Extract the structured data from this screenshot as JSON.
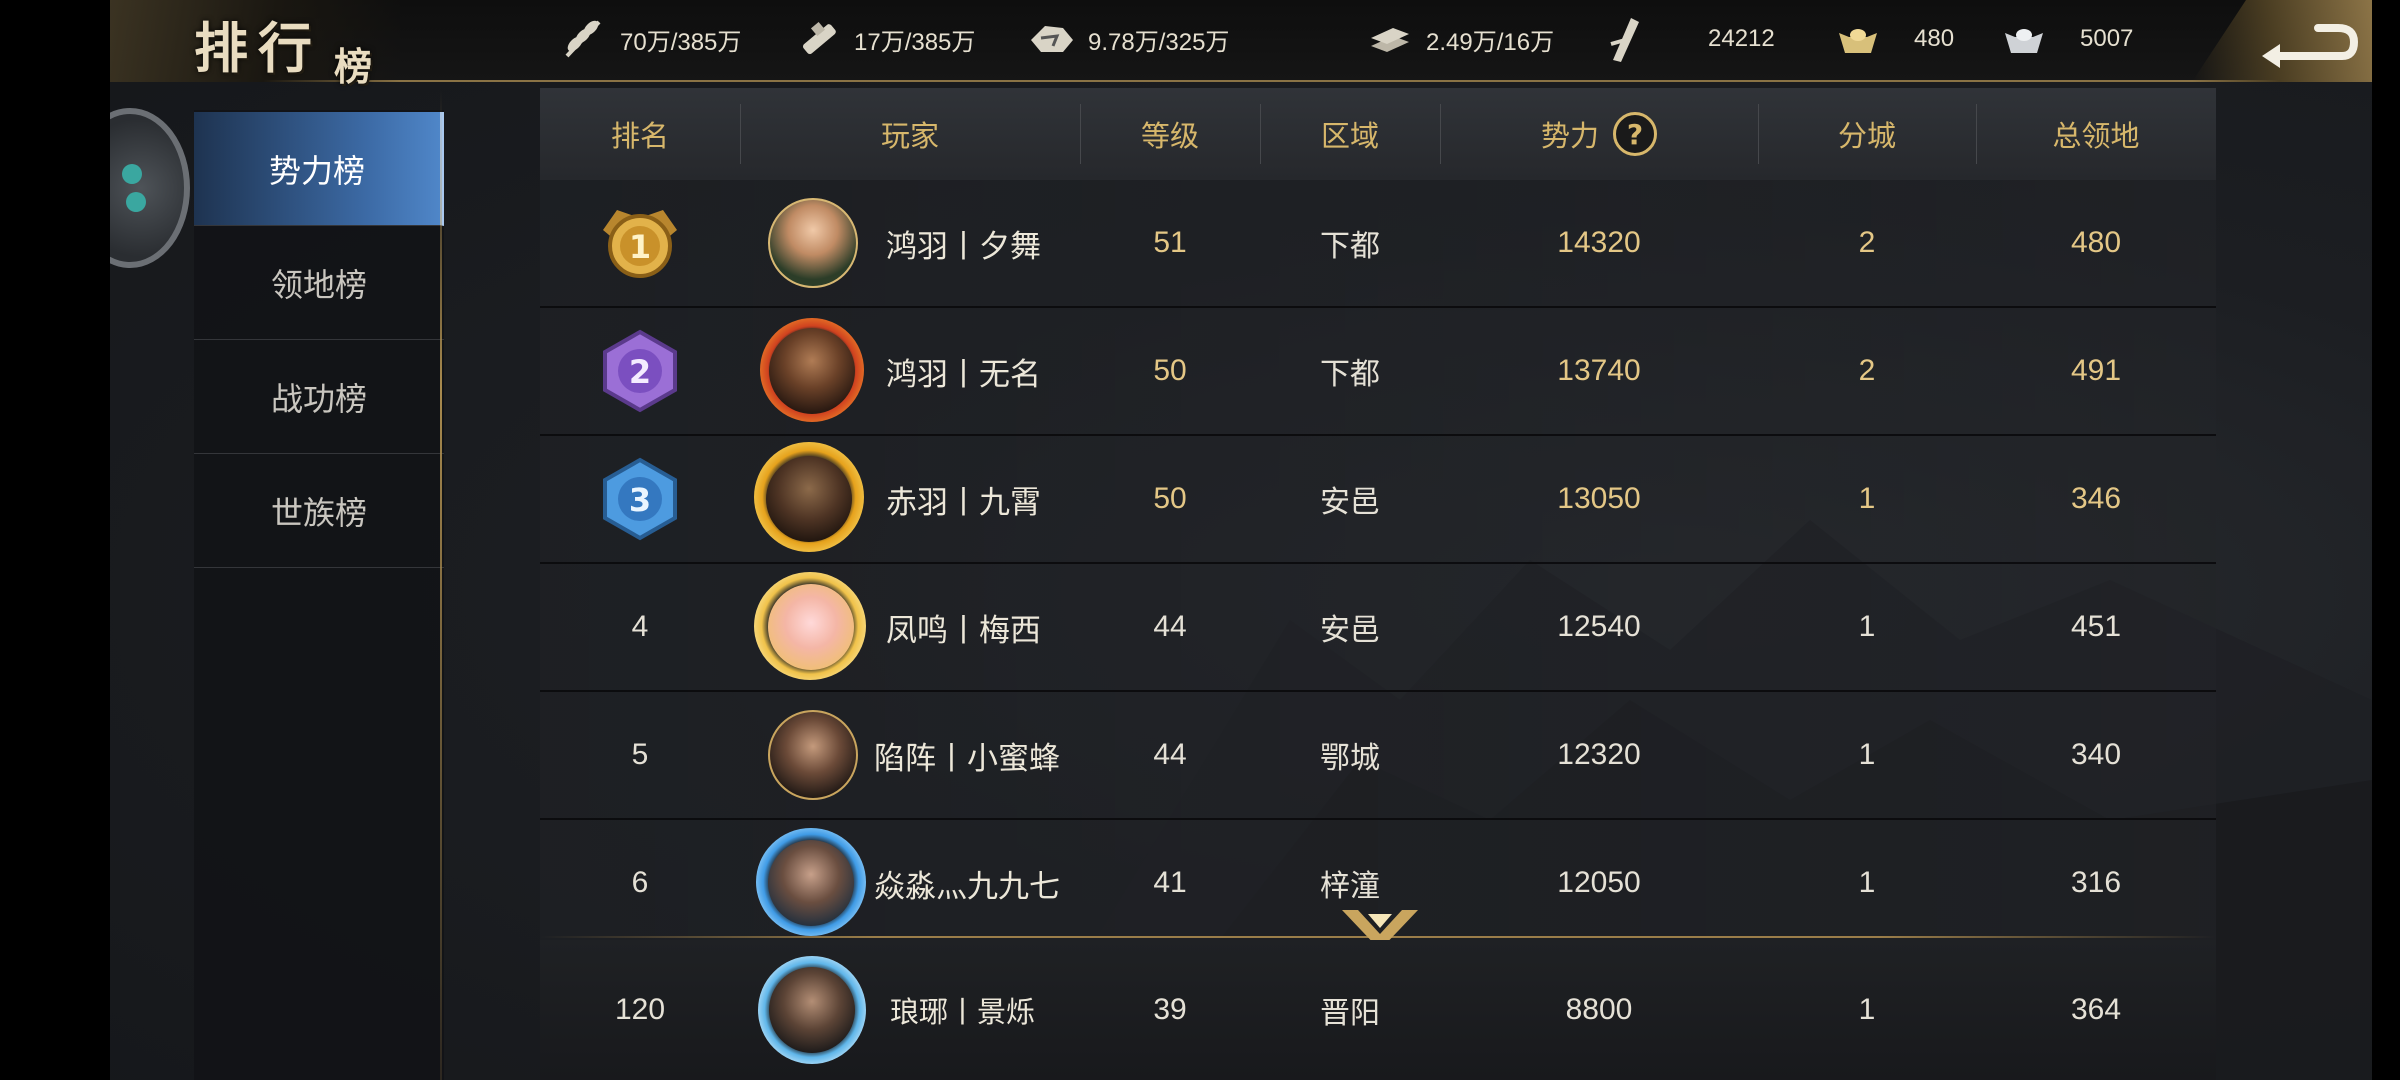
{
  "header": {
    "title_main": "排行",
    "title_sub": "榜",
    "resources": [
      {
        "icon": "wheat-icon",
        "value": "70万/385万"
      },
      {
        "icon": "wood-icon",
        "value": "17万/385万"
      },
      {
        "icon": "stone-icon",
        "value": "9.78万/325万"
      },
      {
        "icon": "iron-icon",
        "value": "2.49万/16万"
      },
      {
        "icon": "decree-icon",
        "value": "24212"
      },
      {
        "icon": "gold-ingot-icon",
        "value": "480"
      },
      {
        "icon": "silver-ingot-icon",
        "value": "5007"
      }
    ]
  },
  "nav": {
    "items": [
      {
        "label": "势力榜",
        "active": true
      },
      {
        "label": "领地榜",
        "active": false
      },
      {
        "label": "战功榜",
        "active": false
      },
      {
        "label": "世族榜",
        "active": false
      }
    ]
  },
  "table": {
    "columns": {
      "rank": "排名",
      "player": "玩家",
      "level": "等级",
      "region": "区域",
      "power": "势力",
      "branch": "分城",
      "territory": "总领地"
    },
    "rows": [
      {
        "rank": "1",
        "name": "鸿羽丨夕舞",
        "level": "51",
        "region": "下都",
        "power": "14320",
        "branch": "2",
        "territory": "480",
        "medal": "gold",
        "frame": "plain"
      },
      {
        "rank": "2",
        "name": "鸿羽丨无名",
        "level": "50",
        "region": "下都",
        "power": "13740",
        "branch": "2",
        "territory": "491",
        "medal": "purple",
        "frame": "lion"
      },
      {
        "rank": "3",
        "name": "赤羽丨九霄",
        "level": "50",
        "region": "安邑",
        "power": "13050",
        "branch": "1",
        "territory": "346",
        "medal": "blue",
        "frame": "dragon"
      },
      {
        "rank": "4",
        "name": "凤鸣丨梅西",
        "level": "44",
        "region": "安邑",
        "power": "12540",
        "branch": "1",
        "territory": "451",
        "medal": "",
        "frame": "cloud"
      },
      {
        "rank": "5",
        "name": "陷阵丨小蜜蜂",
        "level": "44",
        "region": "鄂城",
        "power": "12320",
        "branch": "1",
        "territory": "340",
        "medal": "",
        "frame": "plain"
      },
      {
        "rank": "6",
        "name": "焱淼灬九九七",
        "level": "41",
        "region": "梓潼",
        "power": "12050",
        "branch": "1",
        "territory": "316",
        "medal": "",
        "frame": "water"
      }
    ],
    "self": {
      "rank": "120",
      "name": "琅琊丨景烁",
      "level": "39",
      "region": "晋阳",
      "power": "8800",
      "branch": "1",
      "territory": "364",
      "frame": "snow"
    }
  },
  "colors": {
    "gold_text": "#d7b76b",
    "active_tab": "#3c6aa5",
    "medal_gold": "#e2b24a",
    "medal_purple": "#9b6fd6",
    "medal_blue": "#4d9be0"
  }
}
